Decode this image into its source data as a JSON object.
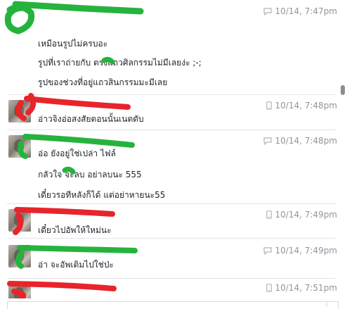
{
  "groups": [
    {
      "name": "",
      "timestamp": "10/14, 7:47pm",
      "timestamp_icon": "speech-bubble-icon",
      "has_avatar": false,
      "redaction_color": "#25b33d",
      "messages": [
        "เหมือนรูปไม่ครบอะ",
        "รูปที่เราถ่ายกับ      ตรงแถวศิลกรรมไม่มีเลยง่ะ ;-;",
        "รูปของช่วงที่อยู่แถวสินกรรมมะมีเลย"
      ]
    },
    {
      "name": "",
      "timestamp": "10/14, 7:48pm",
      "timestamp_icon": "mobile-phone-icon",
      "has_avatar": true,
      "redaction_color": "#e8242b",
      "messages": [
        "อ่าวจิงอ่อสงสัยตอนนั้นเนตดับ"
      ]
    },
    {
      "name": "",
      "timestamp": "10/14, 7:48pm",
      "timestamp_icon": "speech-bubble-icon",
      "has_avatar": true,
      "redaction_color": "#25b33d",
      "messages": [
        "อ่อ ยังอยู่ใช่เปล่า ไฟล์",
        "กลัวใจ    จะลบ อย่าลบนะ 555",
        "เดี๋ยวรอทีหลังก็ได้ แต่อย่าหายนะ55"
      ]
    },
    {
      "name": "",
      "timestamp": "10/14, 7:49pm",
      "timestamp_icon": "mobile-phone-icon",
      "has_avatar": true,
      "redaction_color": "#e8242b",
      "messages": [
        "เดี๋ยวไปอัพให้ใหม่นะ"
      ]
    },
    {
      "name": "",
      "timestamp": "10/14, 7:49pm",
      "timestamp_icon": "speech-bubble-icon",
      "has_avatar": true,
      "redaction_color": "#25b33d",
      "messages": [
        "อ่า จะอัพเดิมไปใช่ป่ะ"
      ]
    },
    {
      "name": "",
      "timestamp": "10/14, 7:51pm",
      "timestamp_icon": "mobile-phone-icon",
      "has_avatar": true,
      "redaction_color": "#e8242b",
      "messages": []
    }
  ]
}
